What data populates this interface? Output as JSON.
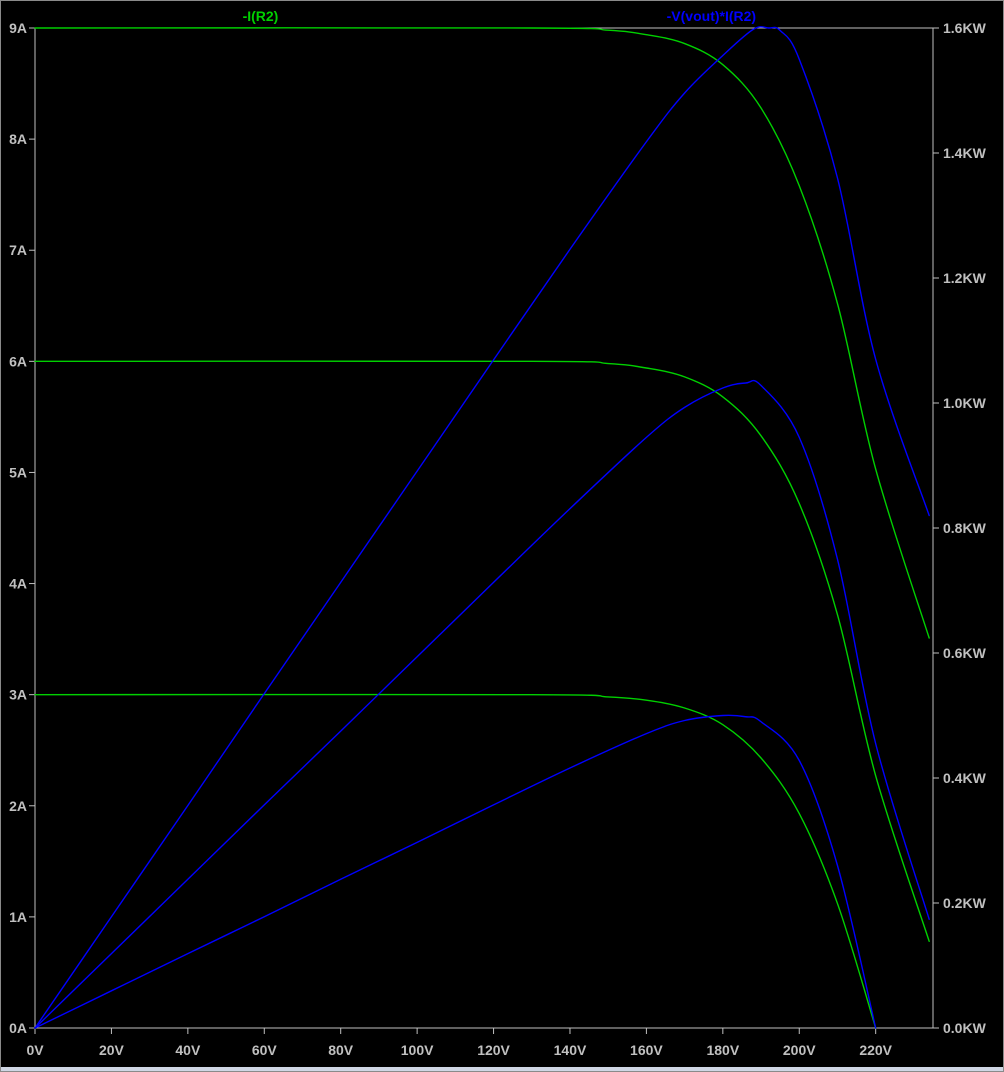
{
  "chart_data": {
    "type": "line",
    "background": "#000000",
    "axis_color": "#c0c0c0",
    "trace_labels": [
      {
        "text": "-I(R2)",
        "color": "#00d000"
      },
      {
        "text": "-V(vout)*I(R2)",
        "color": "#0000ff"
      }
    ],
    "x_axis": {
      "range": [
        0,
        235
      ],
      "ticks": [
        0,
        20,
        40,
        60,
        80,
        100,
        120,
        140,
        160,
        180,
        200,
        220
      ],
      "tick_labels": [
        "0V",
        "20V",
        "40V",
        "60V",
        "80V",
        "100V",
        "120V",
        "140V",
        "160V",
        "180V",
        "200V",
        "220V"
      ]
    },
    "y_left": {
      "range": [
        0,
        9
      ],
      "ticks": [
        0,
        1,
        2,
        3,
        4,
        5,
        6,
        7,
        8,
        9
      ],
      "tick_labels": [
        "0A",
        "1A",
        "2A",
        "3A",
        "4A",
        "5A",
        "6A",
        "7A",
        "8A",
        "9A"
      ]
    },
    "y_right": {
      "range": [
        0,
        1.6
      ],
      "ticks": [
        0,
        0.2,
        0.4,
        0.6,
        0.8,
        1.0,
        1.2,
        1.4,
        1.6
      ],
      "tick_labels": [
        "0.0KW",
        "0.2KW",
        "0.4KW",
        "0.6KW",
        "0.8KW",
        "1.0KW",
        "1.2KW",
        "1.4KW",
        "1.6KW"
      ]
    },
    "series": [
      {
        "axis": "left",
        "color": "#00d000",
        "points": [
          [
            0,
            3
          ],
          [
            130,
            3
          ],
          [
            150,
            2.98
          ],
          [
            160,
            2.95
          ],
          [
            170,
            2.88
          ],
          [
            180,
            2.73
          ],
          [
            190,
            2.43
          ],
          [
            200,
            1.93
          ],
          [
            210,
            1.12
          ],
          [
            220,
            0
          ]
        ]
      },
      {
        "axis": "left",
        "color": "#00d000",
        "points": [
          [
            0,
            6
          ],
          [
            130,
            6
          ],
          [
            150,
            5.98
          ],
          [
            160,
            5.94
          ],
          [
            170,
            5.86
          ],
          [
            180,
            5.68
          ],
          [
            190,
            5.33
          ],
          [
            200,
            4.72
          ],
          [
            210,
            3.72
          ],
          [
            220,
            2.27
          ],
          [
            234,
            0.78
          ]
        ]
      },
      {
        "axis": "left",
        "color": "#00d000",
        "points": [
          [
            0,
            9
          ],
          [
            130,
            9
          ],
          [
            150,
            8.98
          ],
          [
            160,
            8.94
          ],
          [
            170,
            8.86
          ],
          [
            180,
            8.67
          ],
          [
            190,
            8.28
          ],
          [
            200,
            7.58
          ],
          [
            210,
            6.52
          ],
          [
            220,
            5.03
          ],
          [
            234,
            3.51
          ]
        ]
      },
      {
        "axis": "right",
        "color": "#0000ff",
        "points": [
          [
            0,
            0
          ],
          [
            20,
            0.0595
          ],
          [
            40,
            0.119
          ],
          [
            60,
            0.178
          ],
          [
            80,
            0.238
          ],
          [
            100,
            0.297
          ],
          [
            120,
            0.357
          ],
          [
            140,
            0.416
          ],
          [
            160,
            0.471
          ],
          [
            170,
            0.492
          ],
          [
            180,
            0.5
          ],
          [
            186,
            0.498
          ],
          [
            190,
            0.49
          ],
          [
            200,
            0.428
          ],
          [
            210,
            0.26
          ],
          [
            220,
            0
          ]
        ]
      },
      {
        "axis": "right",
        "color": "#0000ff",
        "points": [
          [
            0,
            0
          ],
          [
            20,
            0.119
          ],
          [
            40,
            0.238
          ],
          [
            60,
            0.357
          ],
          [
            80,
            0.475
          ],
          [
            100,
            0.594
          ],
          [
            120,
            0.713
          ],
          [
            140,
            0.831
          ],
          [
            160,
            0.945
          ],
          [
            170,
            0.993
          ],
          [
            180,
            1.024
          ],
          [
            186,
            1.032
          ],
          [
            190,
            1.028
          ],
          [
            200,
            0.945
          ],
          [
            210,
            0.75
          ],
          [
            220,
            0.455
          ],
          [
            234,
            0.174
          ]
        ]
      },
      {
        "axis": "right",
        "color": "#0000ff",
        "points": [
          [
            0,
            0
          ],
          [
            20,
            0.178
          ],
          [
            40,
            0.356
          ],
          [
            60,
            0.535
          ],
          [
            80,
            0.713
          ],
          [
            100,
            0.891
          ],
          [
            120,
            1.069
          ],
          [
            140,
            1.246
          ],
          [
            160,
            1.418
          ],
          [
            170,
            1.496
          ],
          [
            180,
            1.556
          ],
          [
            188,
            1.598
          ],
          [
            192,
            1.6
          ],
          [
            195,
            1.596
          ],
          [
            200,
            1.55
          ],
          [
            210,
            1.36
          ],
          [
            220,
            1.07
          ],
          [
            234,
            0.82
          ]
        ]
      }
    ]
  }
}
